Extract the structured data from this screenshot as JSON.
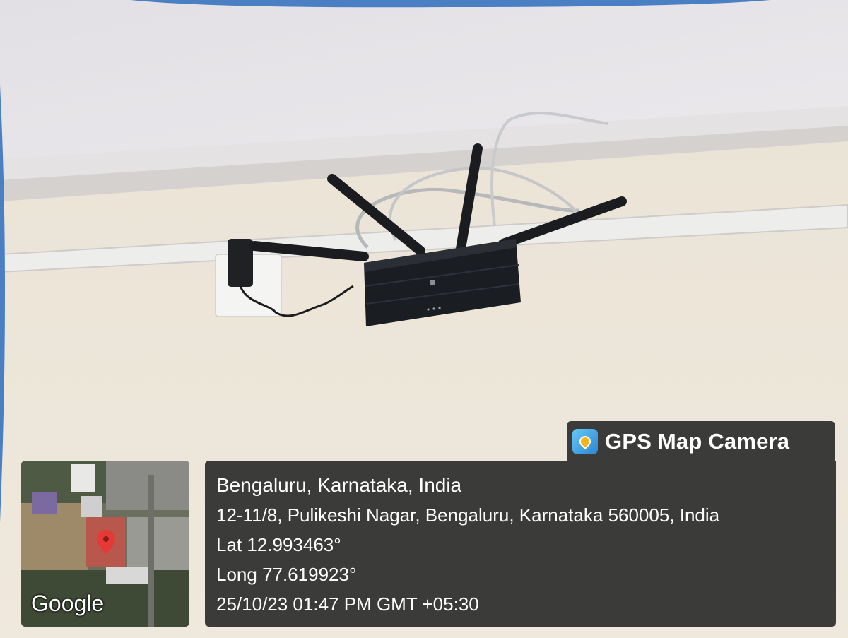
{
  "overlay": {
    "app_name": "GPS Map Camera",
    "app_icon": "gps-map-camera-app-icon",
    "map_credit": "Google",
    "place": "Bengaluru, Karnataka, India",
    "address": "12-11/8, Pulikeshi Nagar, Bengaluru, Karnataka 560005, India",
    "latitude": "Lat 12.993463°",
    "longitude": "Long 77.619923°",
    "timestamp": "25/10/23 01:47 PM GMT +05:30"
  },
  "colors": {
    "frame_blue": "#4a7fc4",
    "wall": "#ece4d6",
    "ceiling": "#e6e4e7",
    "overlay_bg": "#3b3b39",
    "router": "#1a1d21",
    "map_pin": "#e53935"
  }
}
